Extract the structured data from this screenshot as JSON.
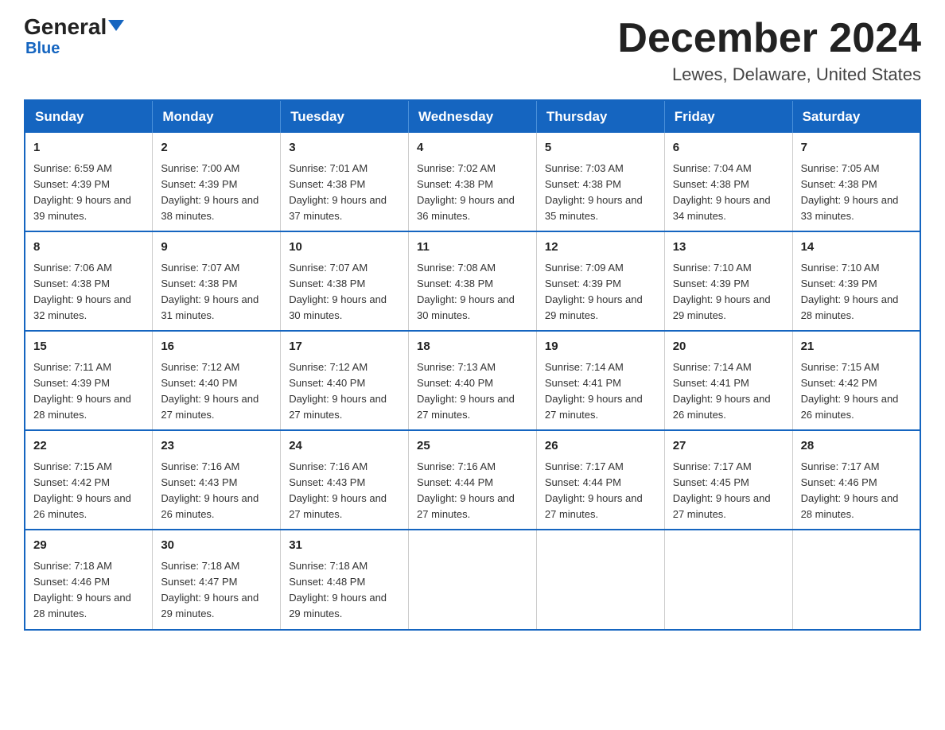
{
  "header": {
    "logo_general": "General",
    "logo_blue": "Blue",
    "month_title": "December 2024",
    "location": "Lewes, Delaware, United States"
  },
  "days_of_week": [
    "Sunday",
    "Monday",
    "Tuesday",
    "Wednesday",
    "Thursday",
    "Friday",
    "Saturday"
  ],
  "weeks": [
    [
      {
        "day": "1",
        "sunrise": "6:59 AM",
        "sunset": "4:39 PM",
        "daylight": "9 hours and 39 minutes."
      },
      {
        "day": "2",
        "sunrise": "7:00 AM",
        "sunset": "4:39 PM",
        "daylight": "9 hours and 38 minutes."
      },
      {
        "day": "3",
        "sunrise": "7:01 AM",
        "sunset": "4:38 PM",
        "daylight": "9 hours and 37 minutes."
      },
      {
        "day": "4",
        "sunrise": "7:02 AM",
        "sunset": "4:38 PM",
        "daylight": "9 hours and 36 minutes."
      },
      {
        "day": "5",
        "sunrise": "7:03 AM",
        "sunset": "4:38 PM",
        "daylight": "9 hours and 35 minutes."
      },
      {
        "day": "6",
        "sunrise": "7:04 AM",
        "sunset": "4:38 PM",
        "daylight": "9 hours and 34 minutes."
      },
      {
        "day": "7",
        "sunrise": "7:05 AM",
        "sunset": "4:38 PM",
        "daylight": "9 hours and 33 minutes."
      }
    ],
    [
      {
        "day": "8",
        "sunrise": "7:06 AM",
        "sunset": "4:38 PM",
        "daylight": "9 hours and 32 minutes."
      },
      {
        "day": "9",
        "sunrise": "7:07 AM",
        "sunset": "4:38 PM",
        "daylight": "9 hours and 31 minutes."
      },
      {
        "day": "10",
        "sunrise": "7:07 AM",
        "sunset": "4:38 PM",
        "daylight": "9 hours and 30 minutes."
      },
      {
        "day": "11",
        "sunrise": "7:08 AM",
        "sunset": "4:38 PM",
        "daylight": "9 hours and 30 minutes."
      },
      {
        "day": "12",
        "sunrise": "7:09 AM",
        "sunset": "4:39 PM",
        "daylight": "9 hours and 29 minutes."
      },
      {
        "day": "13",
        "sunrise": "7:10 AM",
        "sunset": "4:39 PM",
        "daylight": "9 hours and 29 minutes."
      },
      {
        "day": "14",
        "sunrise": "7:10 AM",
        "sunset": "4:39 PM",
        "daylight": "9 hours and 28 minutes."
      }
    ],
    [
      {
        "day": "15",
        "sunrise": "7:11 AM",
        "sunset": "4:39 PM",
        "daylight": "9 hours and 28 minutes."
      },
      {
        "day": "16",
        "sunrise": "7:12 AM",
        "sunset": "4:40 PM",
        "daylight": "9 hours and 27 minutes."
      },
      {
        "day": "17",
        "sunrise": "7:12 AM",
        "sunset": "4:40 PM",
        "daylight": "9 hours and 27 minutes."
      },
      {
        "day": "18",
        "sunrise": "7:13 AM",
        "sunset": "4:40 PM",
        "daylight": "9 hours and 27 minutes."
      },
      {
        "day": "19",
        "sunrise": "7:14 AM",
        "sunset": "4:41 PM",
        "daylight": "9 hours and 27 minutes."
      },
      {
        "day": "20",
        "sunrise": "7:14 AM",
        "sunset": "4:41 PM",
        "daylight": "9 hours and 26 minutes."
      },
      {
        "day": "21",
        "sunrise": "7:15 AM",
        "sunset": "4:42 PM",
        "daylight": "9 hours and 26 minutes."
      }
    ],
    [
      {
        "day": "22",
        "sunrise": "7:15 AM",
        "sunset": "4:42 PM",
        "daylight": "9 hours and 26 minutes."
      },
      {
        "day": "23",
        "sunrise": "7:16 AM",
        "sunset": "4:43 PM",
        "daylight": "9 hours and 26 minutes."
      },
      {
        "day": "24",
        "sunrise": "7:16 AM",
        "sunset": "4:43 PM",
        "daylight": "9 hours and 27 minutes."
      },
      {
        "day": "25",
        "sunrise": "7:16 AM",
        "sunset": "4:44 PM",
        "daylight": "9 hours and 27 minutes."
      },
      {
        "day": "26",
        "sunrise": "7:17 AM",
        "sunset": "4:44 PM",
        "daylight": "9 hours and 27 minutes."
      },
      {
        "day": "27",
        "sunrise": "7:17 AM",
        "sunset": "4:45 PM",
        "daylight": "9 hours and 27 minutes."
      },
      {
        "day": "28",
        "sunrise": "7:17 AM",
        "sunset": "4:46 PM",
        "daylight": "9 hours and 28 minutes."
      }
    ],
    [
      {
        "day": "29",
        "sunrise": "7:18 AM",
        "sunset": "4:46 PM",
        "daylight": "9 hours and 28 minutes."
      },
      {
        "day": "30",
        "sunrise": "7:18 AM",
        "sunset": "4:47 PM",
        "daylight": "9 hours and 29 minutes."
      },
      {
        "day": "31",
        "sunrise": "7:18 AM",
        "sunset": "4:48 PM",
        "daylight": "9 hours and 29 minutes."
      },
      null,
      null,
      null,
      null
    ]
  ]
}
